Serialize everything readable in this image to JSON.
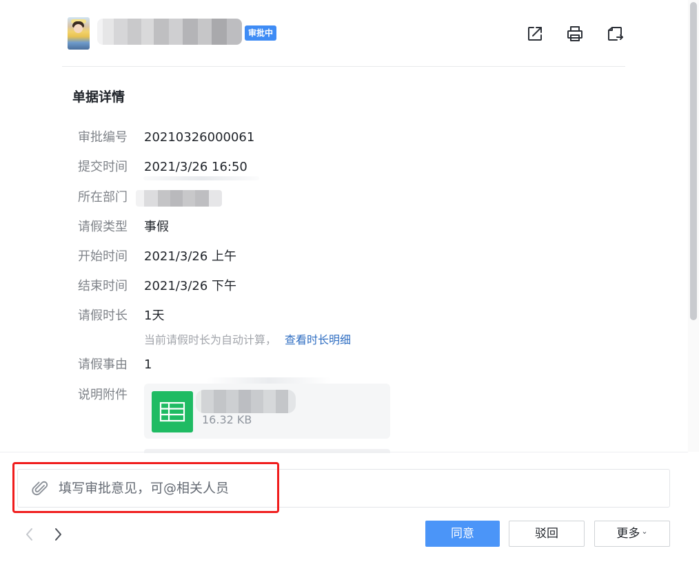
{
  "header": {
    "status_badge": "审批中",
    "icons": [
      "share-icon",
      "print-icon",
      "transfer-icon"
    ]
  },
  "detail": {
    "section_title": "单据详情",
    "fields": [
      {
        "label": "审批编号",
        "value": "20210326000061"
      },
      {
        "label": "提交时间",
        "value": "2021/3/26 16:50"
      },
      {
        "label": "所在部门",
        "value": ""
      },
      {
        "label": "请假类型",
        "value": "事假"
      },
      {
        "label": "开始时间",
        "value": "2021/3/26 上午"
      },
      {
        "label": "结束时间",
        "value": "2021/3/26 下午"
      },
      {
        "label": "请假时长",
        "value": "1天"
      },
      {
        "label": "请假事由",
        "value": "1"
      },
      {
        "label": "说明附件",
        "value": ""
      }
    ],
    "duration_hint": "当前请假时长为自动计算，",
    "duration_link": "查看时长明细",
    "attachment": {
      "size": "16.32 KB",
      "icon": "spreadsheet-icon"
    }
  },
  "footer": {
    "comment_placeholder": "填写审批意见，可@相关人员",
    "approve_label": "同意",
    "reject_label": "驳回",
    "more_label": "更多",
    "colors": {
      "primary": "#4b95f8",
      "badge": "#3f8cf5",
      "link": "#2f6ec2",
      "highlight": "#f01c1c",
      "file_icon": "#1fbb63"
    }
  }
}
